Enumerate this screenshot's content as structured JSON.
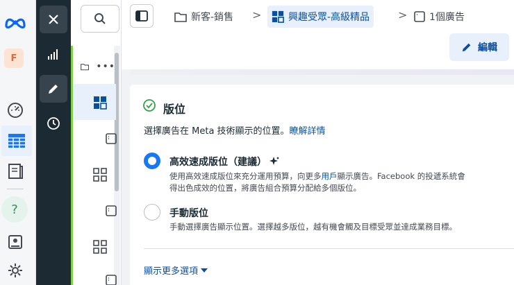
{
  "rail": {
    "avatar_letter": "F",
    "help_glyph": "?"
  },
  "breadcrumb": {
    "campaign": "新客-銷售",
    "adset": "興趣受眾-高級精品",
    "ads": "1個廣告",
    "separator": ">"
  },
  "header": {
    "edit_label": "編輯"
  },
  "placements": {
    "title": "版位",
    "description": "選擇廣告在 Meta 技術顯示的位置。",
    "learn_more": "瞭解詳情",
    "options": [
      {
        "title": "高效速成版位（建議）",
        "desc_prefix": "使用高效速成版位來充分運用預算，向更多",
        "desc_link": "用戶",
        "desc_suffix": "顯示廣告。Facebook 的投遞系統會",
        "desc_line2": "得出色成效的位置，將廣告組合預算分配給多個版位。",
        "selected": true
      },
      {
        "title": "手動版位",
        "desc_line1": "手動選擇廣告顯示位置。選擇越多版位，越有機會觸及目標受眾並達成業務目標。",
        "selected": false
      }
    ],
    "show_more": "顯示更多選項"
  },
  "colors": {
    "accent": "#1877f2",
    "link": "#0a4f9e",
    "dark_panel": "#1c2b33",
    "green_bar": "#7ed24a"
  }
}
